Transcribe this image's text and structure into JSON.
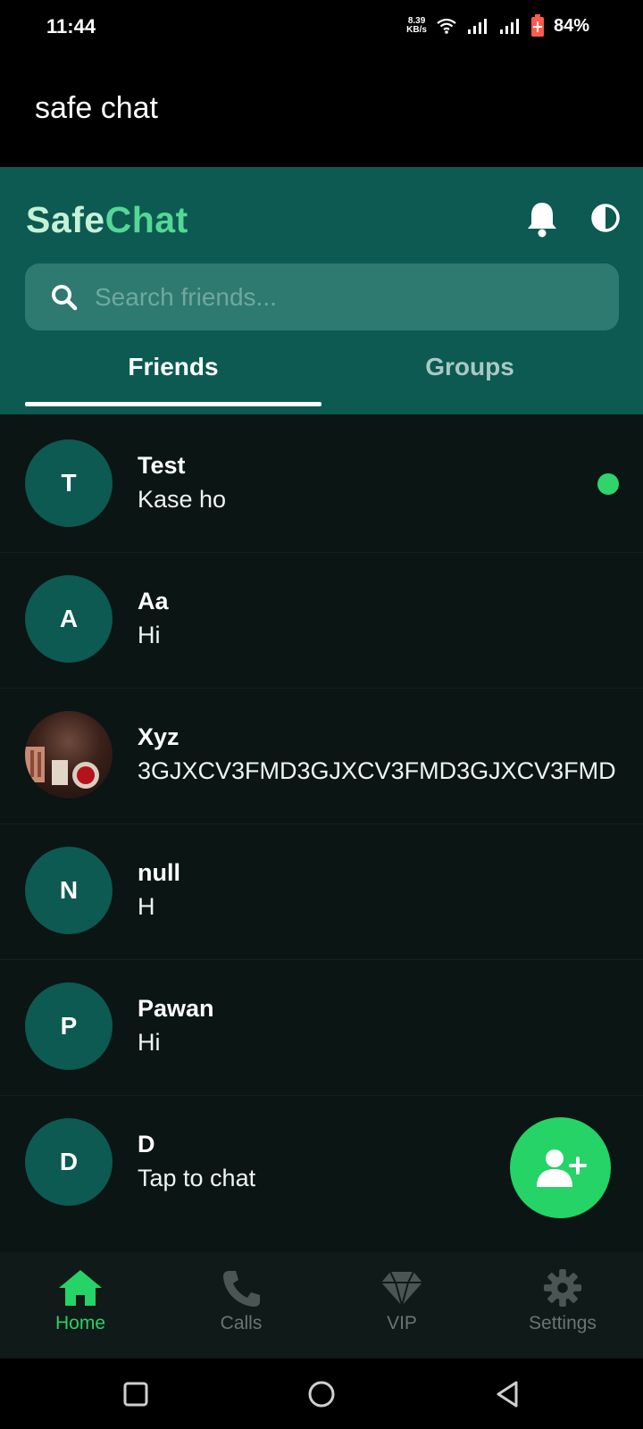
{
  "status_bar": {
    "time": "11:44",
    "net_speed_value": "8.39",
    "net_speed_unit": "KB/s",
    "battery": "84%"
  },
  "app_title": "safe chat",
  "header": {
    "brand_part1": "Safe",
    "brand_part2": "Chat",
    "search_placeholder": "Search friends...",
    "tabs": [
      "Friends",
      "Groups"
    ],
    "active_tab": "Friends"
  },
  "friends": [
    {
      "initial": "T",
      "name": "Test",
      "message": "Kase ho",
      "online": true
    },
    {
      "initial": "A",
      "name": "Aa",
      "message": "Hi",
      "online": false
    },
    {
      "initial": "",
      "name": "Xyz",
      "message": "3GJXCV3FMD3GJXCV3FMD3GJXCV3FMD",
      "online": false,
      "photo": true
    },
    {
      "initial": "N",
      "name": "null",
      "message": "H",
      "online": false
    },
    {
      "initial": "P",
      "name": "Pawan",
      "message": "Hi",
      "online": false
    },
    {
      "initial": "D",
      "name": "D",
      "message": "Tap to chat",
      "online": false
    }
  ],
  "bottom_nav": {
    "items": [
      "Home",
      "Calls",
      "VIP",
      "Settings"
    ],
    "active": "Home"
  },
  "colors": {
    "header_bg": "#0c5a52",
    "accent": "#25d366",
    "list_bg": "#0a1514"
  },
  "icons": {
    "fab": "add-user-icon",
    "header": [
      "bell-icon",
      "contrast-icon"
    ],
    "search": "search-icon"
  }
}
